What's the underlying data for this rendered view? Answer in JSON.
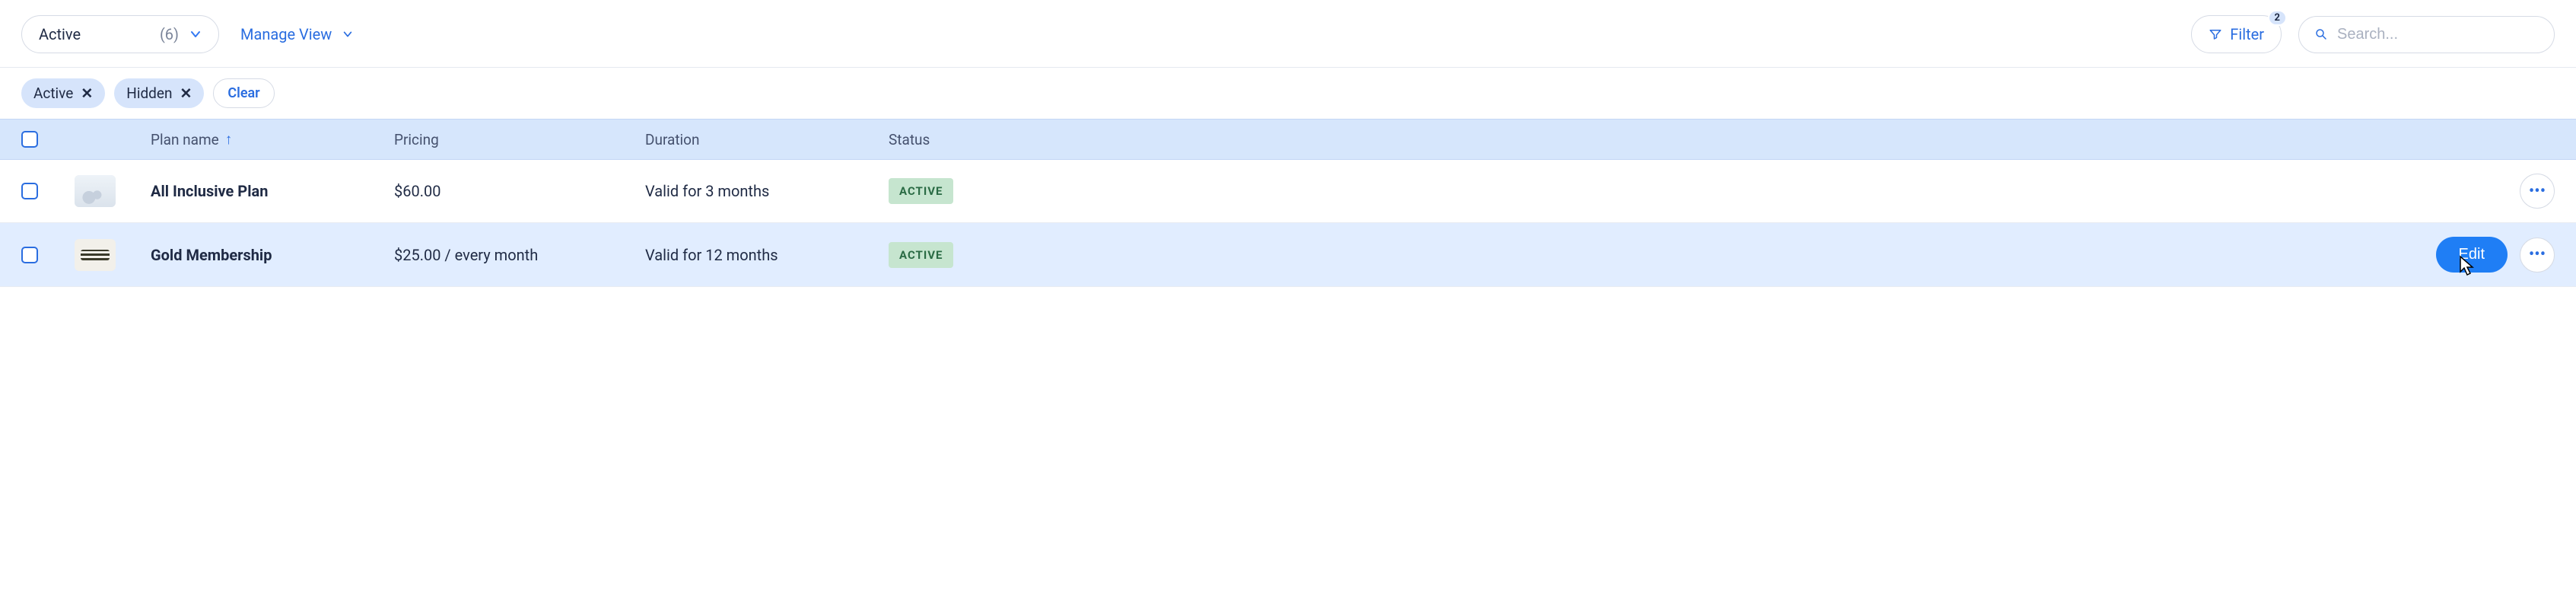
{
  "toolbar": {
    "view_label": "Active",
    "view_count": "(6)",
    "manage_view_label": "Manage View",
    "filter_label": "Filter",
    "filter_badge": "2",
    "search_placeholder": "Search..."
  },
  "filter_chips": [
    {
      "label": "Active"
    },
    {
      "label": "Hidden"
    }
  ],
  "clear_label": "Clear",
  "columns": {
    "plan_name": "Plan name",
    "pricing": "Pricing",
    "duration": "Duration",
    "status": "Status"
  },
  "rows": [
    {
      "name": "All Inclusive Plan",
      "pricing": "$60.00",
      "duration": "Valid for 3 months",
      "status": "ACTIVE",
      "selected": false,
      "thumb": "a"
    },
    {
      "name": "Gold Membership",
      "pricing": "$25.00 / every month",
      "duration": "Valid for 12 months",
      "status": "ACTIVE",
      "selected": true,
      "thumb": "b"
    }
  ],
  "edit_label": "Edit"
}
